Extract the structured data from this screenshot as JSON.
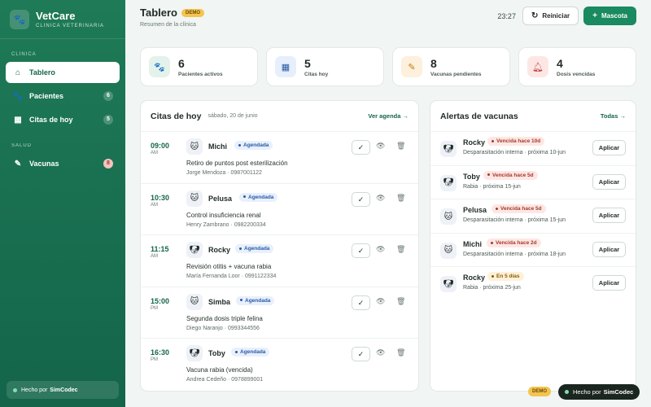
{
  "sidebar": {
    "brand_name": "VetCare",
    "brand_sub": "CLÍNICA VETERINARIA",
    "section_main": "CLÍNICA",
    "section_health": "SALUD",
    "items": [
      {
        "label": "Tablero",
        "icon": "home-icon"
      },
      {
        "label": "Pacientes",
        "icon": "paw-icon",
        "badge": "6"
      },
      {
        "label": "Citas de hoy",
        "icon": "calendar-icon",
        "badge": "5"
      },
      {
        "label": "Vacunas",
        "icon": "syringe-icon",
        "badge": "8"
      }
    ],
    "footer_prefix": "Hecho por",
    "footer_brand": "SimCodec"
  },
  "header": {
    "title": "Tablero",
    "demo": "DEMO",
    "subtitle": "Resumen de la clínica",
    "time": "23:27",
    "reset_label": "Reiniciar",
    "add_label": "Mascota"
  },
  "stats": [
    {
      "value": "6",
      "label": "Pacientes activos",
      "icon": "paw-icon",
      "color": "#e3f3ec"
    },
    {
      "value": "5",
      "label": "Citas hoy",
      "icon": "calendar-icon",
      "color": "#e6effb"
    },
    {
      "value": "8",
      "label": "Vacunas pendientes",
      "icon": "syringe-icon",
      "color": "#fdf0dc"
    },
    {
      "value": "4",
      "label": "Dosis vencidas",
      "icon": "bell-icon",
      "color": "#fde7e4"
    }
  ],
  "appointments": {
    "title": "Citas de hoy",
    "date": "sábado, 20 de junio",
    "link": "Ver agenda →",
    "rows": [
      {
        "time": "09:00",
        "ampm": "AM",
        "name": "Michi",
        "status": "Agendada",
        "reason": "Retiro de puntos post esterilización",
        "owner": "Jorge Mendoza · 0987001122",
        "pet": "cat"
      },
      {
        "time": "10:30",
        "ampm": "AM",
        "name": "Pelusa",
        "status": "Agendada",
        "reason": "Control insuficiencia renal",
        "owner": "Henry Zambrano · 0982200334",
        "pet": "cat"
      },
      {
        "time": "11:15",
        "ampm": "AM",
        "name": "Rocky",
        "status": "Agendada",
        "reason": "Revisión otitis + vacuna rabia",
        "owner": "María Fernanda Loor · 0991122334",
        "pet": "dog"
      },
      {
        "time": "15:00",
        "ampm": "PM",
        "name": "Simba",
        "status": "Agendada",
        "reason": "Segunda dosis triple felina",
        "owner": "Diego Naranjo · 0993344556",
        "pet": "cat"
      },
      {
        "time": "16:30",
        "ampm": "PM",
        "name": "Toby",
        "status": "Agendada",
        "reason": "Vacuna rabia (vencida)",
        "owner": "Andrea Cedeño · 0978899001",
        "pet": "dog"
      }
    ]
  },
  "alerts": {
    "title": "Alertas de vacunas",
    "link": "Todas →",
    "action_label": "Aplicar",
    "rows": [
      {
        "name": "Rocky",
        "badge": "Vencida hace 10d",
        "level": "danger",
        "detail": "Desparasitación interna · próxima 10-jun",
        "pet": "dog"
      },
      {
        "name": "Toby",
        "badge": "Vencida hace 5d",
        "level": "danger",
        "detail": "Rabia · próxima 15-jun",
        "pet": "dog"
      },
      {
        "name": "Pelusa",
        "badge": "Vencida hace 5d",
        "level": "danger",
        "detail": "Desparasitación interna · próxima 15-jun",
        "pet": "cat"
      },
      {
        "name": "Michi",
        "badge": "Vencida hace 2d",
        "level": "danger",
        "detail": "Desparasitación interna · próxima 18-jun",
        "pet": "cat"
      },
      {
        "name": "Rocky",
        "badge": "En 5 días",
        "level": "warn",
        "detail": "Rabia · próxima 25-jun",
        "pet": "dog"
      }
    ]
  },
  "floating": {
    "demo": "DEMO",
    "made_prefix": "Hecho por",
    "made_brand": "SimCodec"
  },
  "colors": {
    "brand": "#1a8a60",
    "danger": "#a43a2c",
    "warn": "#8a5a0a"
  }
}
